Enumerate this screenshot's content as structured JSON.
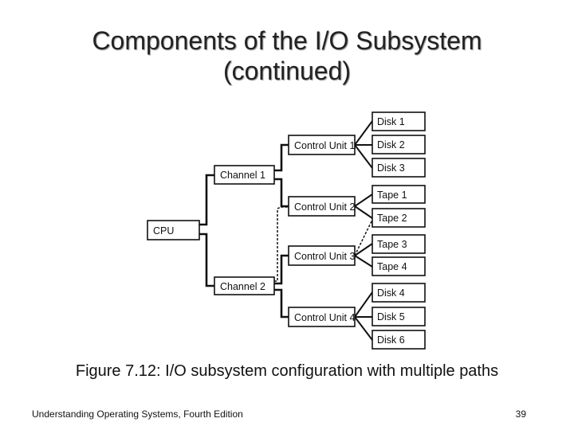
{
  "slide": {
    "title_line1": "Components of the I/O Subsystem",
    "title_line2": "(continued)",
    "caption": "Figure 7.12: I/O subsystem configuration with multiple paths",
    "footer_left": "Understanding Operating Systems, Fourth Edition",
    "page_number": "39"
  },
  "diagram": {
    "nodes": {
      "cpu": "CPU",
      "channel1": "Channel 1",
      "channel2": "Channel 2",
      "cu1": "Control Unit 1",
      "cu2": "Control Unit 2",
      "cu3": "Control Unit 3",
      "cu4": "Control Unit 4",
      "disk1": "Disk 1",
      "disk2": "Disk 2",
      "disk3": "Disk 3",
      "tape1": "Tape 1",
      "tape2": "Tape 2",
      "tape3": "Tape 3",
      "tape4": "Tape 4",
      "disk4": "Disk 4",
      "disk5": "Disk 5",
      "disk6": "Disk 6"
    },
    "edges": [
      {
        "from": "cpu",
        "to": "channel1",
        "style": "solid"
      },
      {
        "from": "cpu",
        "to": "channel2",
        "style": "solid"
      },
      {
        "from": "channel1",
        "to": "cu1",
        "style": "solid"
      },
      {
        "from": "channel1",
        "to": "cu2",
        "style": "solid"
      },
      {
        "from": "channel2",
        "to": "cu2",
        "style": "dashed"
      },
      {
        "from": "channel2",
        "to": "cu3",
        "style": "solid"
      },
      {
        "from": "channel2",
        "to": "cu4",
        "style": "solid"
      },
      {
        "from": "cu1",
        "to": "disk1",
        "style": "solid"
      },
      {
        "from": "cu1",
        "to": "disk2",
        "style": "solid"
      },
      {
        "from": "cu1",
        "to": "disk3",
        "style": "solid"
      },
      {
        "from": "cu2",
        "to": "tape1",
        "style": "solid"
      },
      {
        "from": "cu2",
        "to": "tape2",
        "style": "solid"
      },
      {
        "from": "cu3",
        "to": "tape2",
        "style": "dashed"
      },
      {
        "from": "cu3",
        "to": "tape3",
        "style": "solid"
      },
      {
        "from": "cu3",
        "to": "tape4",
        "style": "solid"
      },
      {
        "from": "cu4",
        "to": "disk4",
        "style": "solid"
      },
      {
        "from": "cu4",
        "to": "disk5",
        "style": "solid"
      },
      {
        "from": "cu4",
        "to": "disk6",
        "style": "solid"
      }
    ]
  }
}
